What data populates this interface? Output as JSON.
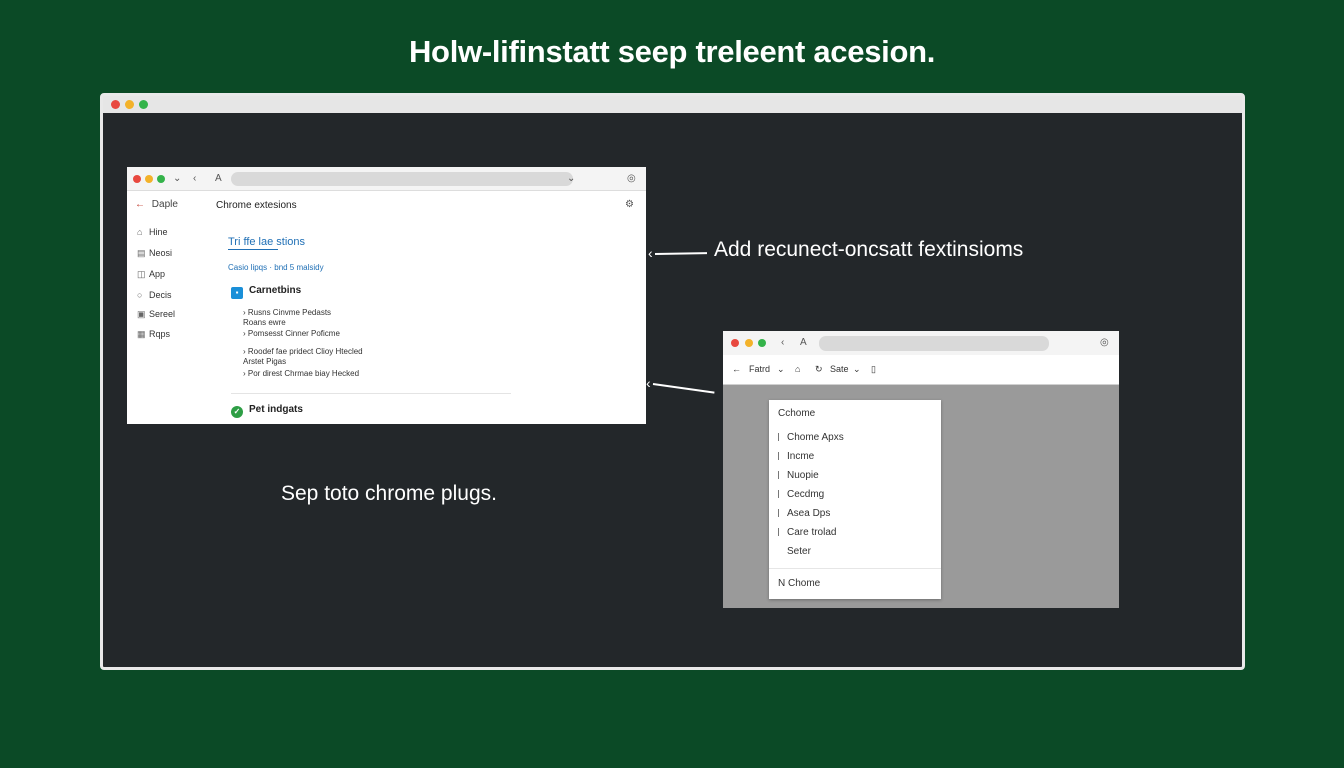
{
  "headline": "Holw-lifinstatt seep treleent acesion.",
  "colors": {
    "background": "#0b4a26",
    "inner_dark": "#23272a",
    "link_blue": "#1f6fb5",
    "back_red": "#c0392b"
  },
  "left_panel": {
    "address_glyph": "A",
    "back_label": "Daple",
    "page_heading": "Chrome extesions",
    "sidebar": [
      {
        "icon": "home-icon",
        "label": "Hine"
      },
      {
        "icon": "news-icon",
        "label": "Neosi"
      },
      {
        "icon": "apps-icon",
        "label": "App"
      },
      {
        "icon": "docs-icon",
        "label": "Decis"
      },
      {
        "icon": "settings-icon",
        "label": "Sereel"
      },
      {
        "icon": "grid-icon",
        "label": "Rqps"
      }
    ],
    "link_text": "Tri ffe lae stions",
    "sublink_text": "Casio lipqs · bnd 5 malsidy",
    "section1_title": "Carnetbins",
    "section1_bullets": [
      "Rusns Cinvme Pedasts\nRoans ewre",
      "Pomsesst Cinner Poficme",
      "Roodef fae pridect Clioy Htecled\nArstet Pigas",
      "Por direst Chrmae biay Hecked"
    ],
    "section2_title": "Pet indgats"
  },
  "annotation_top": "Add recunect-oncsatt fextinsioms",
  "annotation_bottom": "Sep toto chrome plugs.",
  "right_panel": {
    "address_glyph": "A",
    "toolbar": {
      "back": "Fatrd",
      "tab": "Sate"
    },
    "menu_title": "Cchome",
    "menu_items": [
      "Chome Apxs",
      "Incme",
      "Nuopie",
      "Cecdmg",
      "Asea Dps",
      "Care trolad"
    ],
    "menu_plain": "Seter",
    "menu_footer": "N Chome"
  }
}
